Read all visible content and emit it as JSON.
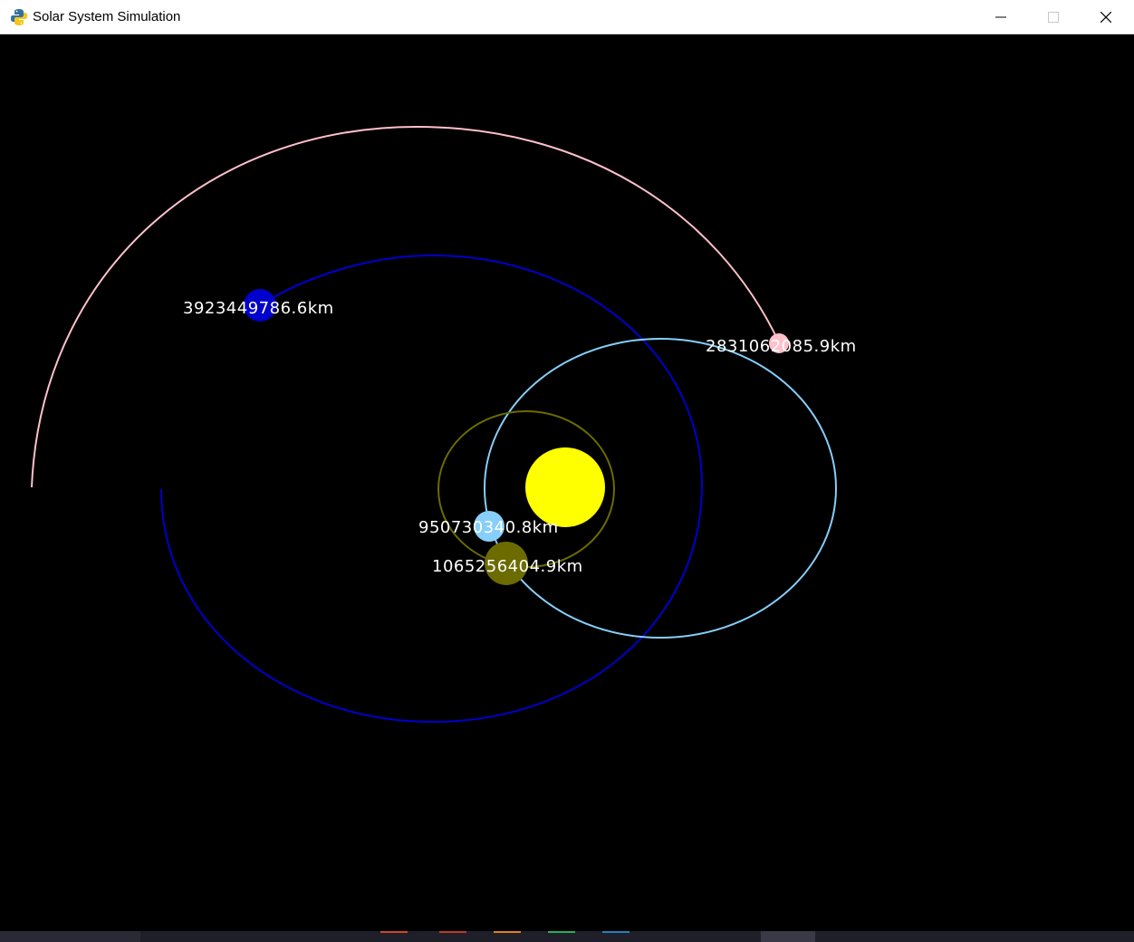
{
  "window": {
    "title": "Solar System Simulation",
    "icon": "python-icon"
  },
  "controls": {
    "minimize_icon": "minimize-icon",
    "maximize_icon": "maximize-icon",
    "close_icon": "close-icon"
  },
  "simulation": {
    "background": "#000000",
    "sun": {
      "color": "#ffff00"
    },
    "planets": [
      {
        "label": "3923449786.6km",
        "color": "#0000cc",
        "orbit_color": "#0000cc"
      },
      {
        "label": "2831062085.9km",
        "color": "#ffc0cb",
        "orbit_color": "#ffc0cb"
      },
      {
        "label": "950730340.8km",
        "color": "#87cefa",
        "orbit_color": "#87cefa"
      },
      {
        "label": "1065256404.9km",
        "color": "#6b6b00",
        "orbit_color": "#6b6b00"
      }
    ]
  }
}
